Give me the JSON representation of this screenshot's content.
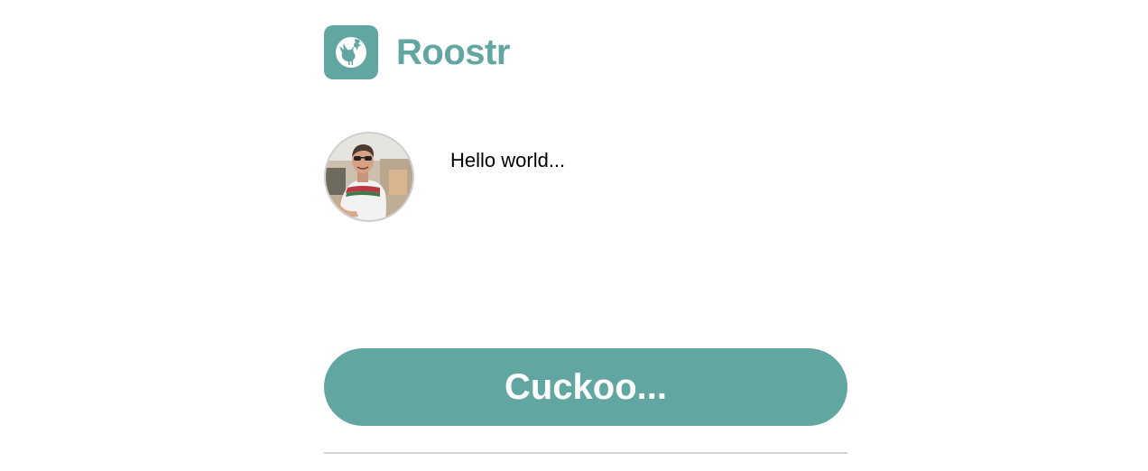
{
  "header": {
    "app_name": "Roostr",
    "logo_icon": "rooster-icon"
  },
  "composer": {
    "avatar_icon": "user-avatar-photo",
    "placeholder": "Hello world...",
    "value": ""
  },
  "submit": {
    "label": "Cuckoo..."
  },
  "colors": {
    "brand": "#62a6a2",
    "button_text": "#ffffff",
    "divider": "#d3d3d3"
  }
}
